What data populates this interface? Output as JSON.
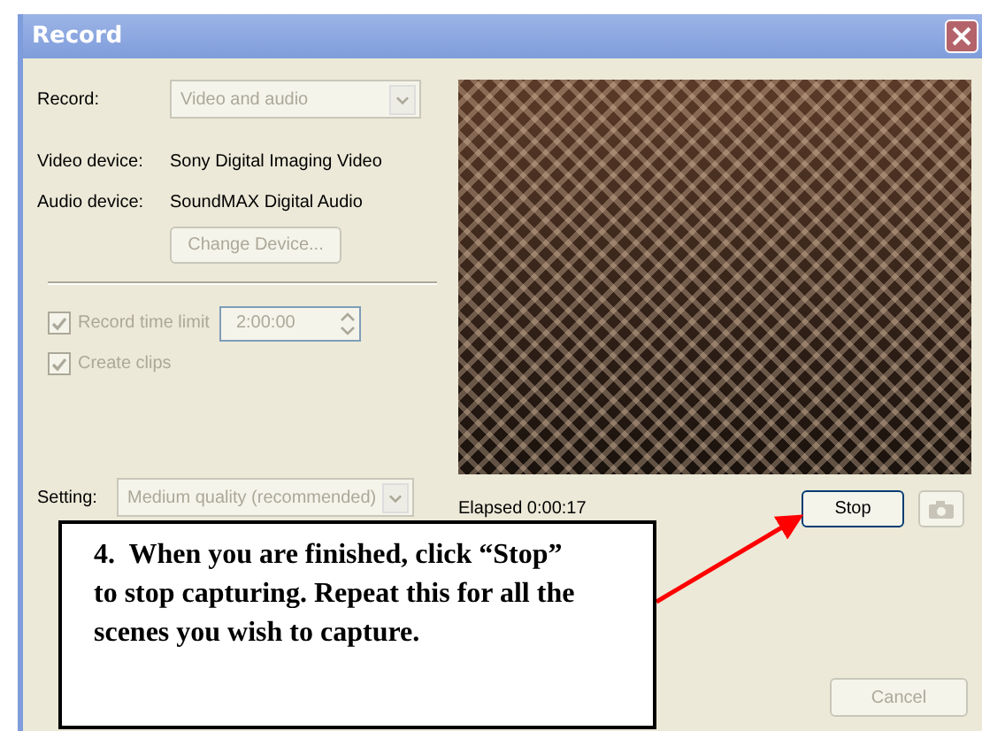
{
  "window": {
    "title": "Record"
  },
  "record": {
    "label": "Record:",
    "value": "Video and audio",
    "disabled": true
  },
  "devices": [
    {
      "label": "Video device:",
      "value": "Sony Digital Imaging Video"
    },
    {
      "label": "Audio device:",
      "value": "SoundMAX Digital Audio"
    }
  ],
  "change_device": {
    "label": "Change Device...",
    "disabled": true
  },
  "options": [
    {
      "kind": "checkbox-time",
      "label": "Record time limit",
      "checked": true,
      "disabled": true,
      "value": "2:00:00"
    },
    {
      "kind": "checkbox",
      "label": "Create clips",
      "checked": true,
      "disabled": true
    }
  ],
  "setting": {
    "label": "Setting:",
    "value": "Medium quality (recommended)",
    "disabled": true
  },
  "elapsed": {
    "label": "Elapsed",
    "value": "0:00:17"
  },
  "buttons": [
    {
      "kind": "text",
      "label": "Stop",
      "disabled": false
    },
    {
      "kind": "camera",
      "disabled": true
    }
  ],
  "cancel": {
    "label": "Cancel",
    "disabled": true
  },
  "callout": {
    "text": "4.  When you are finished, click “Stop” to stop capturing. Repeat this for all the scenes you wish to capture."
  }
}
